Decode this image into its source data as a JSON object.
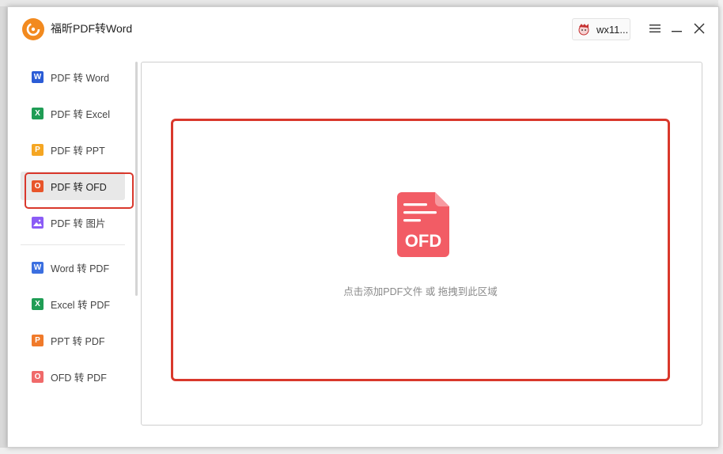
{
  "app": {
    "title": "福昕PDF转Word",
    "user": "wx11..."
  },
  "sidebar": {
    "items": [
      {
        "label": "PDF 转 Word",
        "icon": "word-icon",
        "glyph": "W",
        "color": "#2b5cd6"
      },
      {
        "label": "PDF 转 Excel",
        "icon": "excel-icon",
        "glyph": "X",
        "color": "#1f9d55"
      },
      {
        "label": "PDF 转 PPT",
        "icon": "ppt-icon",
        "glyph": "P",
        "color": "#f5a623"
      },
      {
        "label": "PDF 转 OFD",
        "icon": "ofd-icon",
        "glyph": "O",
        "color": "#e8552b",
        "active": true
      },
      {
        "label": "PDF 转 图片",
        "icon": "image-icon",
        "glyph": "",
        "color": "#8b5cf6"
      },
      {
        "label": "Word 转 PDF",
        "icon": "word-outline-icon",
        "glyph": "W",
        "color": "#3b6fe0"
      },
      {
        "label": "Excel 转 PDF",
        "icon": "excel-outline-icon",
        "glyph": "X",
        "color": "#1f9d55"
      },
      {
        "label": "PPT 转 PDF",
        "icon": "ppt-outline-icon",
        "glyph": "P",
        "color": "#f07a2a"
      },
      {
        "label": "OFD 转 PDF",
        "icon": "ofd-outline-icon",
        "glyph": "O",
        "color": "#f06a6a"
      }
    ]
  },
  "main": {
    "file_icon_label": "OFD",
    "drop_hint": "点击添加PDF文件 或 拖拽到此区域"
  },
  "colors": {
    "accent": "#f25c65",
    "highlight": "#d9382c",
    "logo": "#f28a1f"
  }
}
